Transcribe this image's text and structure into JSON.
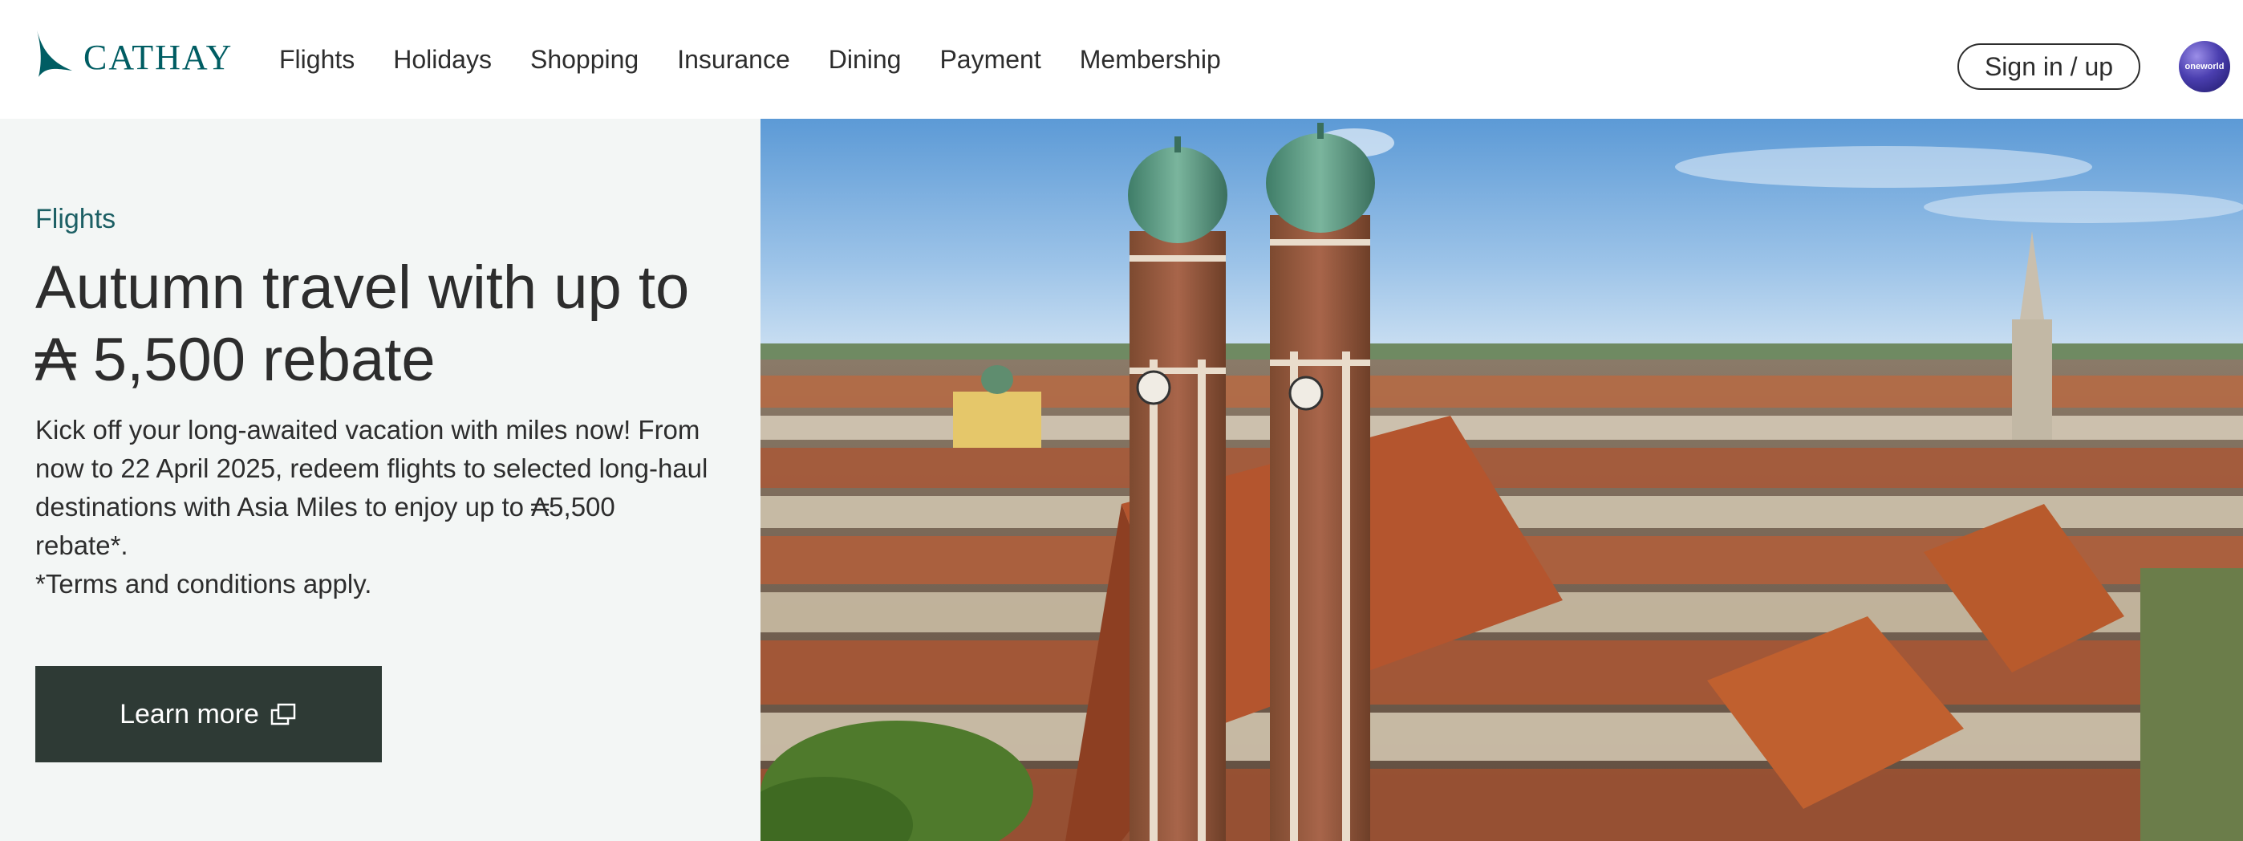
{
  "header": {
    "brand": "CATHAY",
    "nav": [
      "Flights",
      "Holidays",
      "Shopping",
      "Insurance",
      "Dining",
      "Payment",
      "Membership"
    ],
    "signin_label": "Sign in / up",
    "alliance_badge": "oneworld"
  },
  "promo": {
    "eyebrow": "Flights",
    "headline": "Autumn travel with up to ₳ 5,500 rebate",
    "body": "Kick off your long-awaited vacation with miles now! From now to 22 April 2025, redeem flights to selected long-haul destinations with Asia Miles to enjoy up to ₳5,500 rebate*.",
    "terms": "*Terms and conditions apply.",
    "cta_label": "Learn more",
    "cta_icon": "external-link-icon"
  },
  "hero": {
    "icon": "city-skyline-photo"
  },
  "colors": {
    "brand_teal": "#005d63",
    "panel_bg": "#f3f6f5",
    "cta_bg": "#2e3a35",
    "text": "#2d2d2d"
  }
}
